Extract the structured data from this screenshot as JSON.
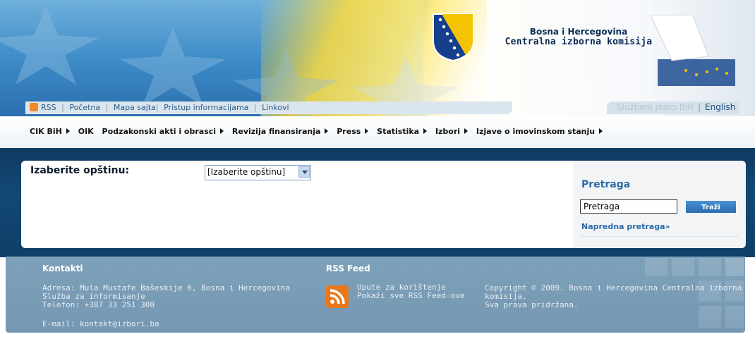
{
  "header": {
    "org_line1": "Bosna i Hercegovina",
    "org_line2": "Centralna izborna komisija"
  },
  "topbar": {
    "rss": "RSS",
    "links": [
      "Početna",
      "Mapa sajta",
      "Pristup informacijama",
      "Linkovi"
    ]
  },
  "language": {
    "official": "Službeni jezici BiH",
    "english": "English"
  },
  "nav": {
    "items": [
      "CIK BiH",
      "OIK",
      "Podzakonski akti i obrasci",
      "Revizija finansiranja",
      "Press",
      "Statistika",
      "Izbori",
      "Izjave o imovinskom stanju"
    ]
  },
  "municipality": {
    "label": "Izaberite opštinu:",
    "selected": "[Izaberite opštinu]"
  },
  "search": {
    "title": "Pretraga",
    "input_value": "Pretraga",
    "button": "Traži",
    "advanced": "Napredna pretraga»"
  },
  "footer": {
    "contacts_title": "Kontakti",
    "address": "Adresa: Mula Mustafe Bašeskije 6, Bosna i Hercegovina",
    "service": "Služba za informisanje",
    "phone": "Telefon: +387 33 251 300",
    "email": "E-mail: kontakt@izbori.ba",
    "rss_title": "RSS Feed",
    "rss_link1": "Upute za korištenje",
    "rss_link2": "Pokaži sve RSS Feed-ove",
    "copyright1": "Copyright © 2009. Bosna i Hercegovina Centralna izborna",
    "copyright2": "komisija.",
    "copyright3": "Sva prava pridržana."
  },
  "colors": {
    "header_blue": "#2f78b7",
    "band_navy": "#124876",
    "accent_link": "#2c6aa6",
    "footer": "#7ea1ba",
    "rss_orange": "#e46b12"
  },
  "icons": [
    "rss-icon",
    "coat-of-arms-icon",
    "ballot-box-icon",
    "dropdown-arrow-icon",
    "rss-feed-icon"
  ]
}
